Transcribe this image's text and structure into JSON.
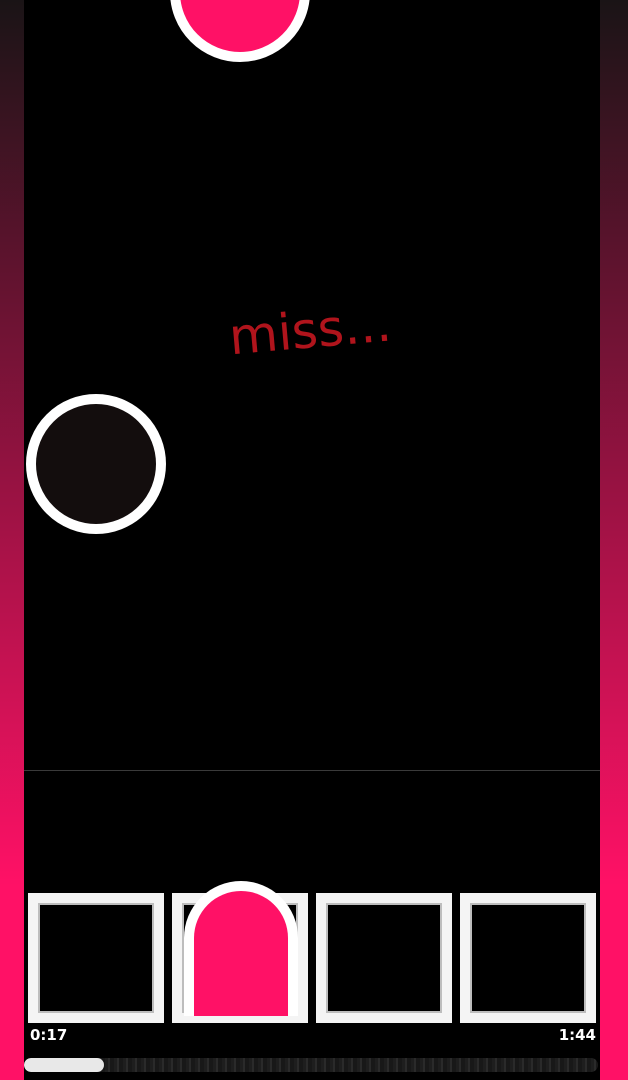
{
  "colors": {
    "note_fill": "#ff1166",
    "note_ring": "#ffffff",
    "dark_note_fill": "#130d0d",
    "side_gradient_top": "#1a1416",
    "side_gradient_bottom": "#ff1166",
    "judgement_text": "#b0141c",
    "judge_line": "#3a3a3a"
  },
  "judgement": {
    "text": "miss..."
  },
  "notes": [
    {
      "name": "note-top",
      "lane": 2,
      "kind": "tap",
      "color": "pink"
    },
    {
      "name": "note-left",
      "lane": 1,
      "kind": "tap",
      "color": "dark"
    }
  ],
  "hold_note": {
    "lane": 2,
    "color": "pink"
  },
  "lane_pads": [
    {
      "lane": 1
    },
    {
      "lane": 2
    },
    {
      "lane": 3
    },
    {
      "lane": 4
    }
  ],
  "playback": {
    "current_time": "0:17",
    "total_time": "1:44",
    "progress": 0.14
  }
}
